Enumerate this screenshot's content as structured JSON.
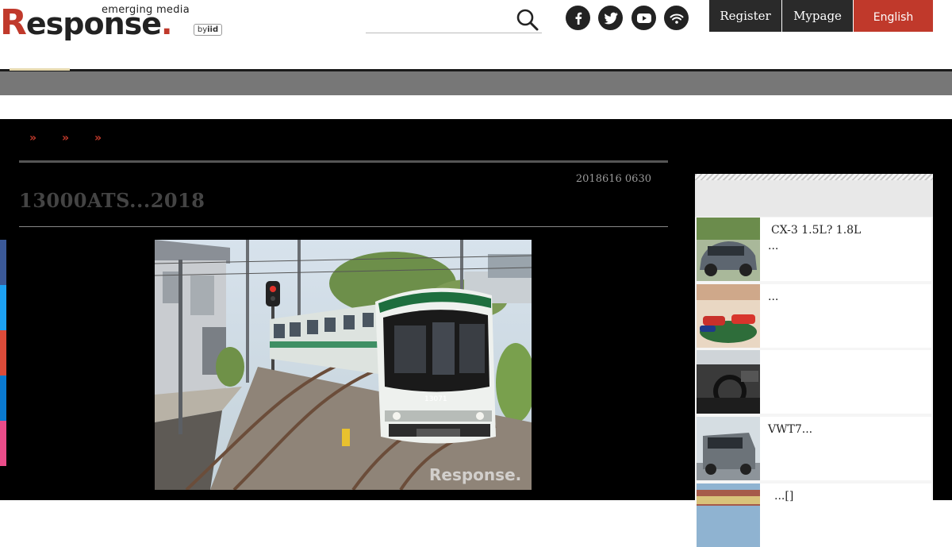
{
  "header": {
    "logo_tag": "emerging media",
    "logo_r": "R",
    "logo_rest": "esponse",
    "logo_dot": ".",
    "logo_by": "by",
    "logo_iid": "iid",
    "search_placeholder": "",
    "social_icons": [
      "facebook-icon",
      "twitter-icon",
      "youtube-icon",
      "rss-icon"
    ],
    "register_label": "Register",
    "mypage_label": "Mypage",
    "english_label": "English"
  },
  "breadcrumb": {
    "separators": [
      "»",
      "»",
      "»"
    ]
  },
  "article": {
    "date": "2018616 0630",
    "title": "13000ATS...2018",
    "photo_watermark": "Response."
  },
  "share_colors": [
    "#3b5998",
    "#1da1f2",
    "#dd4b39",
    "#0a7ad1",
    "#ea4c89"
  ],
  "sidebar": {
    "items": [
      {
        "title": "CX-3 1.5L? 1.8L",
        "subtitle": "..."
      },
      {
        "title": "",
        "subtitle": "..."
      },
      {
        "title": "",
        "subtitle": ""
      },
      {
        "title": "VWT7...",
        "subtitle": ""
      },
      {
        "title": "...[]",
        "subtitle": ""
      }
    ]
  },
  "colors": {
    "brand_red": "#c0392b",
    "dark_button": "#2a2a2a"
  }
}
